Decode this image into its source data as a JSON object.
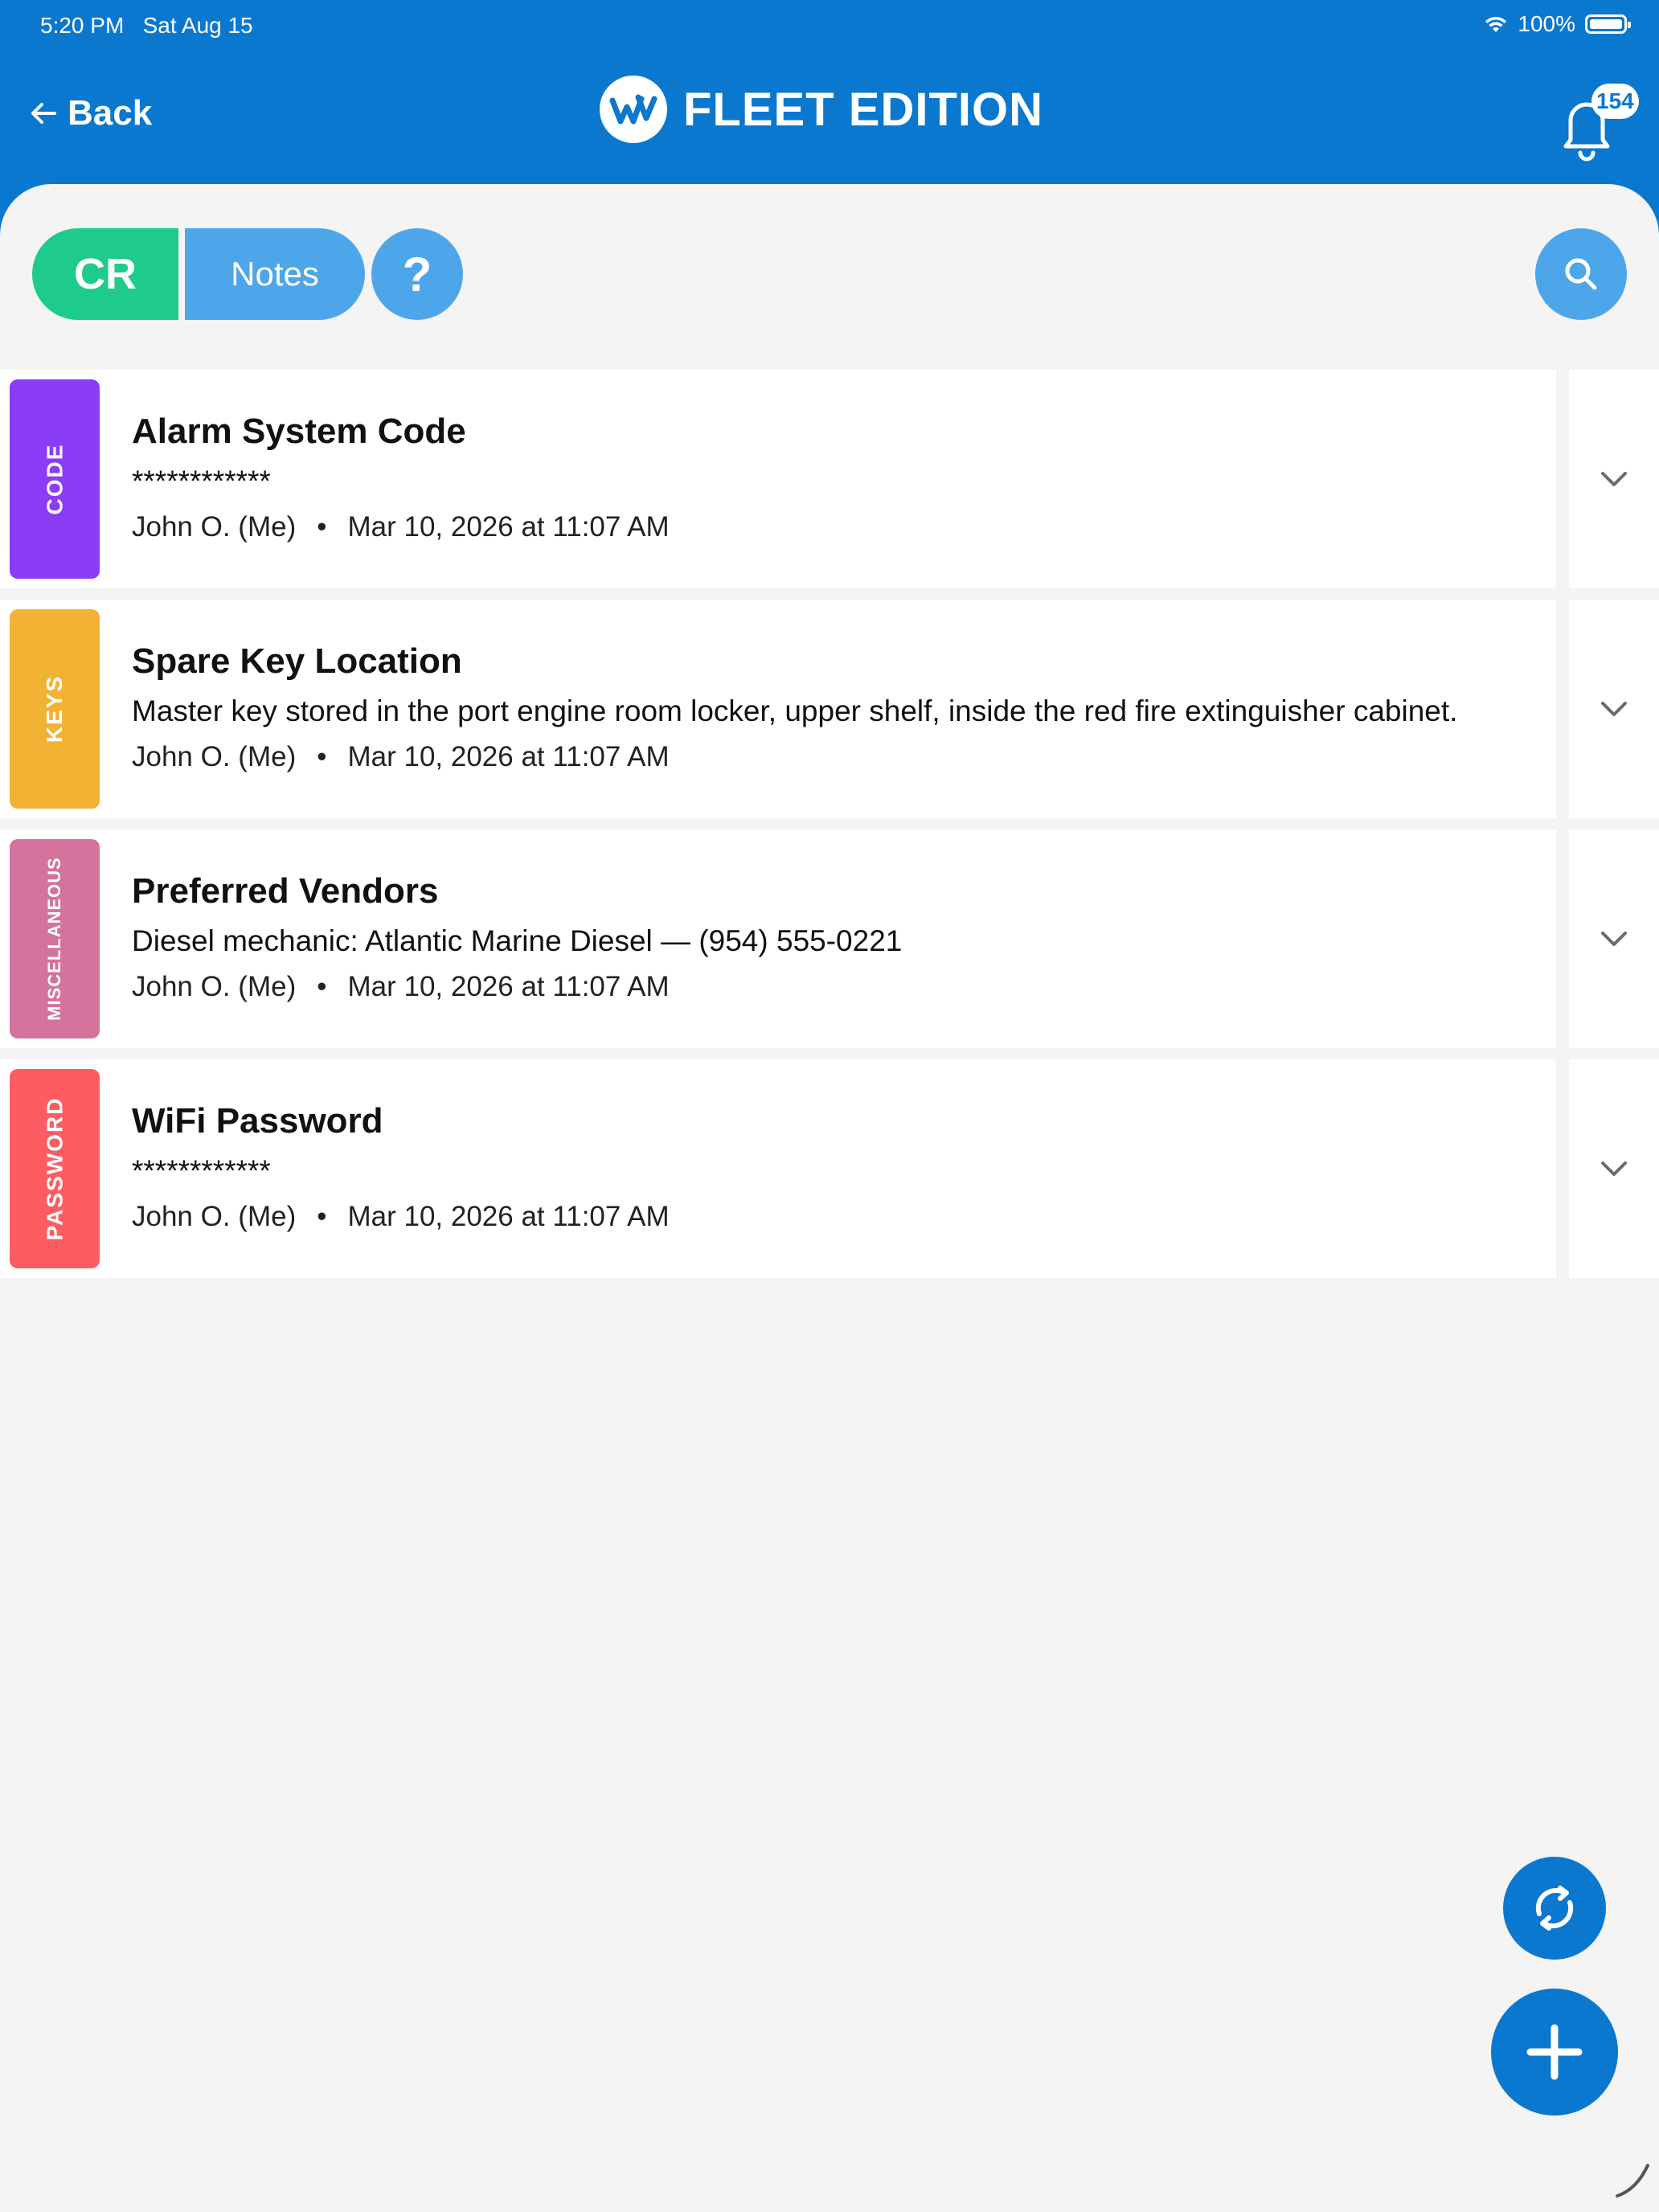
{
  "status_bar": {
    "time": "5:20 PM",
    "date": "Sat Aug 15",
    "battery": "100%"
  },
  "header": {
    "back_label": "Back",
    "brand_name": "FLEET EDITION",
    "notification_count": "154"
  },
  "toolbar": {
    "cr_label": "CR",
    "notes_label": "Notes",
    "help_label": "?"
  },
  "notes": [
    {
      "tag": "CODE",
      "tag_color": "#8b3cf6",
      "title": "Alarm System Code",
      "body": "************",
      "author": "John O. (Me)",
      "separator": "•",
      "timestamp": "Mar 10, 2026 at 11:07 AM"
    },
    {
      "tag": "KEYS",
      "tag_color": "#f2b234",
      "title": "Spare Key Location",
      "body": "Master key stored in the port engine room locker, upper shelf, inside the red fire extinguisher cabinet.",
      "author": "John O. (Me)",
      "separator": "•",
      "timestamp": "Mar 10, 2026 at 11:07 AM"
    },
    {
      "tag": "MISCELLANEOUS",
      "tag_color": "#d4739b",
      "title": "Preferred Vendors",
      "body": "Diesel mechanic: Atlantic Marine Diesel — (954) 555-0221",
      "author": "John O. (Me)",
      "separator": "•",
      "timestamp": "Mar 10, 2026 at 11:07 AM"
    },
    {
      "tag": "PASSWORD",
      "tag_color": "#fd5c63",
      "title": "WiFi Password",
      "body": "************",
      "author": "John O. (Me)",
      "separator": "•",
      "timestamp": "Mar 10, 2026 at 11:07 AM"
    }
  ],
  "colors": {
    "header_blue": "#0b78cf",
    "cr_green": "#1ecb8b",
    "light_blue": "#4ea6ea",
    "background": "#f4f4f4"
  },
  "icons": {
    "back": "arrow-left-icon",
    "brand": "fleet-logo-icon",
    "notifications": "bell-icon",
    "search": "search-icon",
    "expand": "chevron-down-icon",
    "sync": "sync-icon",
    "add": "plus-icon"
  }
}
